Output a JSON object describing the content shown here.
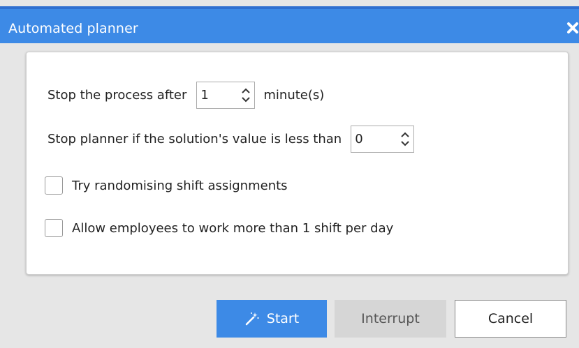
{
  "window": {
    "title": "Automated planner",
    "close_icon": "close-icon"
  },
  "options": {
    "stop_after": {
      "label_before": "Stop the process after",
      "value": "1",
      "label_after": "minute(s)"
    },
    "stop_if_less": {
      "label": "Stop planner if the solution's value is less than",
      "value": "0"
    },
    "randomise": {
      "label": "Try randomising shift assignments",
      "checked": false
    },
    "multi_shift": {
      "label": "Allow employees to work more than 1 shift per day",
      "checked": false
    }
  },
  "buttons": {
    "start": "Start",
    "interrupt": "Interrupt",
    "cancel": "Cancel"
  },
  "colors": {
    "accent": "#3d8ae6",
    "disabled": "#d6d6d6"
  }
}
